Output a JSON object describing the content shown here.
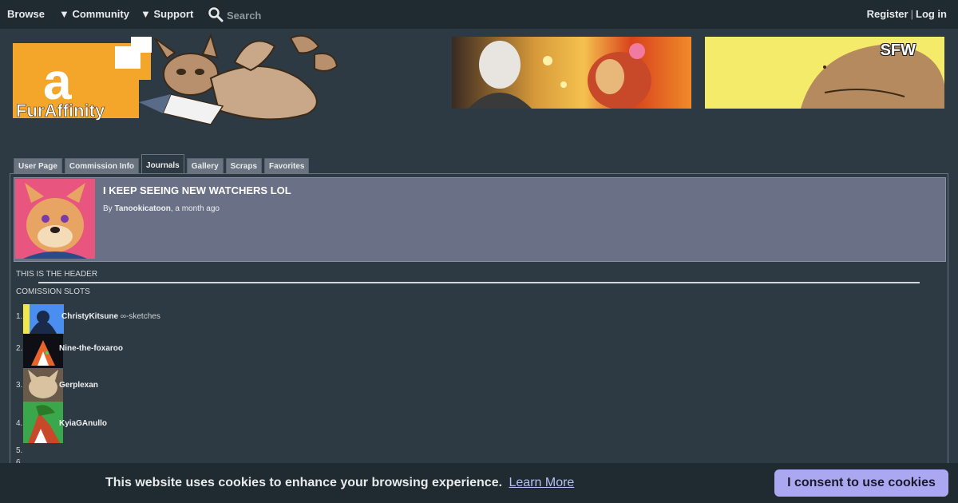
{
  "nav": {
    "browse": "Browse",
    "community": "▼ Community",
    "support": "▼ Support",
    "search_placeholder": "Search",
    "register": "Register",
    "separator": "|",
    "login": "Log in"
  },
  "logo": {
    "text": "FurAffinity"
  },
  "banner2": {
    "badge": "SFW"
  },
  "tabs": [
    "User Page",
    "Commission Info",
    "Journals",
    "Gallery",
    "Scraps",
    "Favorites"
  ],
  "journal": {
    "title": "I KEEP SEEING NEW WATCHERS LOL",
    "by_prefix": "By ",
    "author": "Tanookicatoon",
    "time": ", a month ago",
    "header_text": "THIS IS THE HEADER",
    "section_title": "COMISSION SLOTS",
    "slots": [
      {
        "num": "1.",
        "name": "ChristyKitsune",
        "note": " ∞-sketches"
      },
      {
        "num": "2.",
        "name": "Nine-the-foxaroo",
        "note": ""
      },
      {
        "num": "3.",
        "name": "Gerplexan",
        "note": ""
      },
      {
        "num": "4.",
        "name": "KyiaGAnullo",
        "note": ""
      },
      {
        "num": "5.",
        "name": "",
        "note": ""
      },
      {
        "num": "6.",
        "name": "",
        "note": ""
      }
    ]
  },
  "cookie": {
    "message": "This website uses cookies to enhance your browsing experience.",
    "learn_more": "Learn More",
    "consent": "I consent to use cookies"
  },
  "colors": {
    "background": "#2e3a43",
    "topbar": "#1f2a31",
    "journal_header": "#6a7085",
    "consent_button": "#aba7f0",
    "logo_orange": "#f4a62a"
  }
}
